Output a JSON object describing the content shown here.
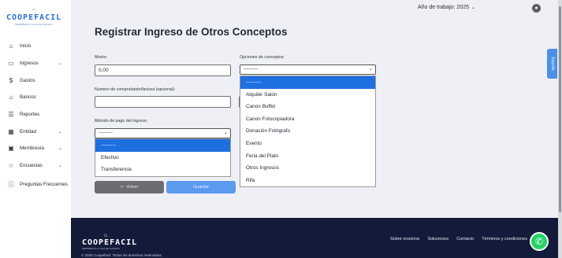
{
  "brand": {
    "name": "COOPEFACIL",
    "tagline": "MEMBRESÍA & CAJA DE AHORRO"
  },
  "topbar": {
    "year_label": "Año de trabajo: 2025"
  },
  "support_tab": "Soporte",
  "sidebar": {
    "items": [
      {
        "label": "Inicio",
        "icon": "home-icon",
        "has_chevron": false
      },
      {
        "label": "Ingresos",
        "icon": "money-icon",
        "has_chevron": true
      },
      {
        "label": "Gastos",
        "icon": "coin-icon",
        "has_chevron": false
      },
      {
        "label": "Bancos",
        "icon": "bank-icon",
        "has_chevron": false
      },
      {
        "label": "Reportes",
        "icon": "report-icon",
        "has_chevron": false
      },
      {
        "label": "Entidad",
        "icon": "entity-icon",
        "has_chevron": true
      },
      {
        "label": "Membresía",
        "icon": "id-card-icon",
        "has_chevron": true
      },
      {
        "label": "Encuestas",
        "icon": "star-icon",
        "has_chevron": true
      },
      {
        "label": "Preguntas Frecuentes",
        "icon": "info-icon",
        "has_chevron": false
      }
    ]
  },
  "form": {
    "title": "Registrar Ingreso de Otros Conceptos",
    "monto_label": "Monto:",
    "monto_value": "0,00",
    "comprobante_label": "Numero de comprobante/factura (opcional):",
    "comprobante_value": "",
    "metodo_label": "Método de pago del ingreso:",
    "metodo_selected": "---------",
    "metodo_options": [
      "---------",
      "Efectivo",
      "Transferencia"
    ],
    "conceptos_label": "Opciones de conceptos:",
    "conceptos_selected": "---------",
    "conceptos_options": [
      "---------",
      "Alquiler Salón",
      "Canon Buffet",
      "Canon Fotocopiadora",
      "Donación Fotógrafo",
      "Evento",
      "Feria del Plato",
      "Otros Ingresos",
      "Rifa"
    ],
    "volver_label": "Volver",
    "guardar_label": "Guardar"
  },
  "footer": {
    "copyright": "© 2025 Coopefacil. Todos los derechos reservados.",
    "links": [
      "Sobre nosotros",
      "Soluciones",
      "Contacto",
      "Términos y condiciones"
    ]
  },
  "colors": {
    "accent": "#1e6fe0",
    "footer_bg": "#131a3a",
    "primary_button": "#5a9bf0",
    "whatsapp": "#25d366"
  }
}
